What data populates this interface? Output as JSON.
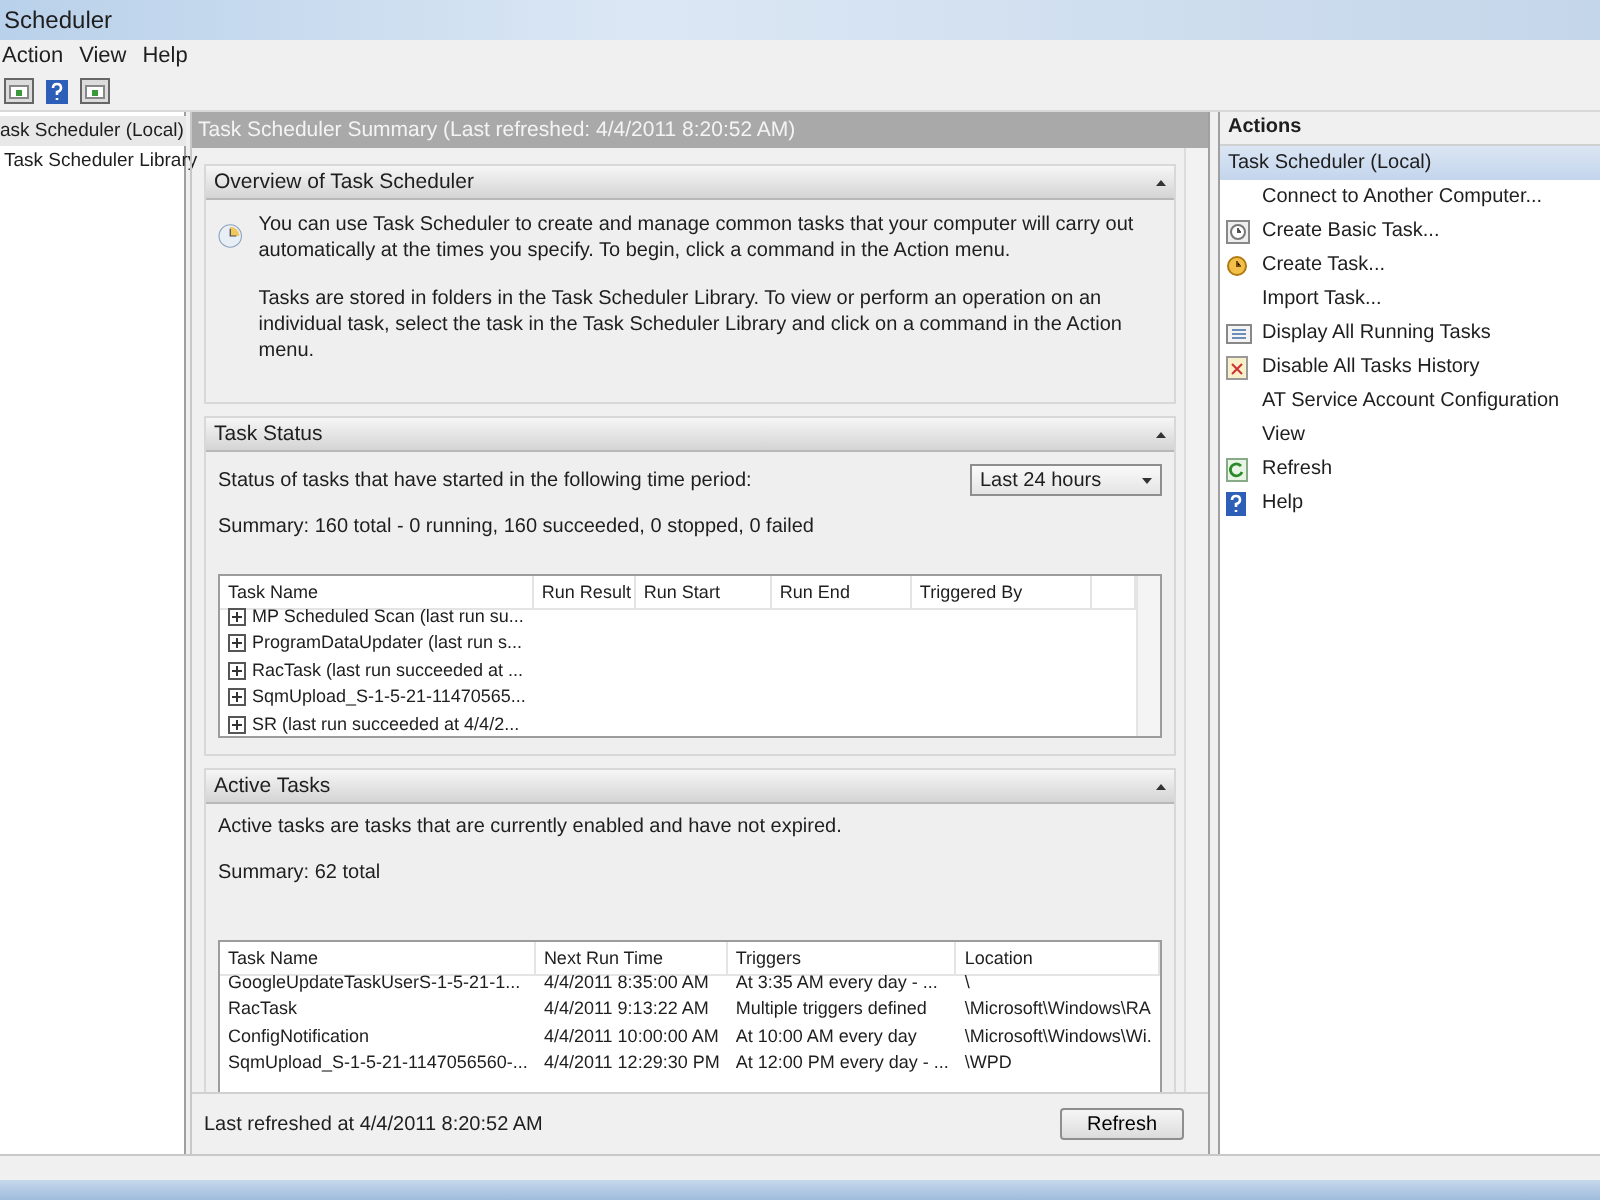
{
  "window": {
    "title": "Scheduler"
  },
  "menu": [
    "Action",
    "View",
    "Help"
  ],
  "tree": [
    {
      "label": "ask Scheduler (Local)",
      "selected": true
    },
    {
      "label": "Task Scheduler Library",
      "selected": false
    }
  ],
  "summary_header": "Task Scheduler Summary (Last refreshed: 4/4/2011 8:20:52 AM)",
  "overview": {
    "title": "Overview of Task Scheduler",
    "expanded": true,
    "paragraphs": [
      "You can use Task Scheduler to create and manage common tasks that your computer will carry out automatically at the times you specify. To begin, click a command in the Action menu.",
      "Tasks are stored in folders in the Task Scheduler Library. To view or perform an operation on an individual task, select the task in the Task Scheduler Library and click on a command in the Action menu."
    ]
  },
  "task_status": {
    "title": "Task Status",
    "expanded": true,
    "prompt": "Status of tasks that have started in the following time period:",
    "period": "Last 24 hours",
    "summary": "Summary: 160 total - 0 running, 160 succeeded, 0 stopped, 0 failed",
    "columns": [
      "Task Name",
      "Run Result",
      "Run Start",
      "Run End",
      "Triggered By"
    ],
    "rows": [
      {
        "name": "MP Scheduled Scan (last run su...",
        "expanded": false
      },
      {
        "name": "ProgramDataUpdater (last run s...",
        "expanded": false
      },
      {
        "name": "RacTask (last run succeeded at ...",
        "expanded": false
      },
      {
        "name": "SqmUpload_S-1-5-21-11470565...",
        "expanded": false
      },
      {
        "name": "SR (last run succeeded at 4/4/2...",
        "expanded": false
      }
    ]
  },
  "active_tasks": {
    "title": "Active Tasks",
    "expanded": true,
    "description": "Active tasks are tasks that are currently enabled and have not expired.",
    "summary": "Summary: 62 total",
    "columns": [
      "Task Name",
      "Next Run Time",
      "Triggers",
      "Location"
    ],
    "rows": [
      [
        "GoogleUpdateTaskUserS-1-5-21-1...",
        "4/4/2011 8:35:00 AM",
        "At 3:35 AM every day - ...",
        "\\"
      ],
      [
        "RacTask",
        "4/4/2011 9:13:22 AM",
        "Multiple triggers defined",
        "\\Microsoft\\Windows\\RA"
      ],
      [
        "ConfigNotification",
        "4/4/2011 10:00:00 AM",
        "At 10:00 AM every day",
        "\\Microsoft\\Windows\\Wi."
      ],
      [
        "SqmUpload_S-1-5-21-1147056560-...",
        "4/4/2011 12:29:30 PM",
        "At 12:00 PM every day - ...",
        "\\WPD"
      ]
    ]
  },
  "footer": {
    "text": "Last refreshed at 4/4/2011 8:20:52 AM",
    "button": "Refresh"
  },
  "actions": {
    "title": "Actions",
    "items": [
      {
        "label": "Task Scheduler (Local)",
        "selected": true,
        "kind": "plain"
      },
      {
        "label": "Connect to Another Computer...",
        "selected": false,
        "kind": "plain"
      },
      {
        "label": "Create Basic Task...",
        "selected": false,
        "kind": "clock"
      },
      {
        "label": "Create Task...",
        "selected": false,
        "kind": "task"
      },
      {
        "label": "Import Task...",
        "selected": false,
        "kind": "plain"
      },
      {
        "label": "Display All Running Tasks",
        "selected": false,
        "kind": "list"
      },
      {
        "label": "Disable All Tasks History",
        "selected": false,
        "kind": "history"
      },
      {
        "label": "AT Service Account Configuration",
        "selected": false,
        "kind": "plain"
      },
      {
        "label": "View",
        "selected": false,
        "kind": "plain"
      },
      {
        "label": "Refresh",
        "selected": false,
        "kind": "refresh"
      },
      {
        "label": "Help",
        "selected": false,
        "kind": "help"
      }
    ]
  }
}
